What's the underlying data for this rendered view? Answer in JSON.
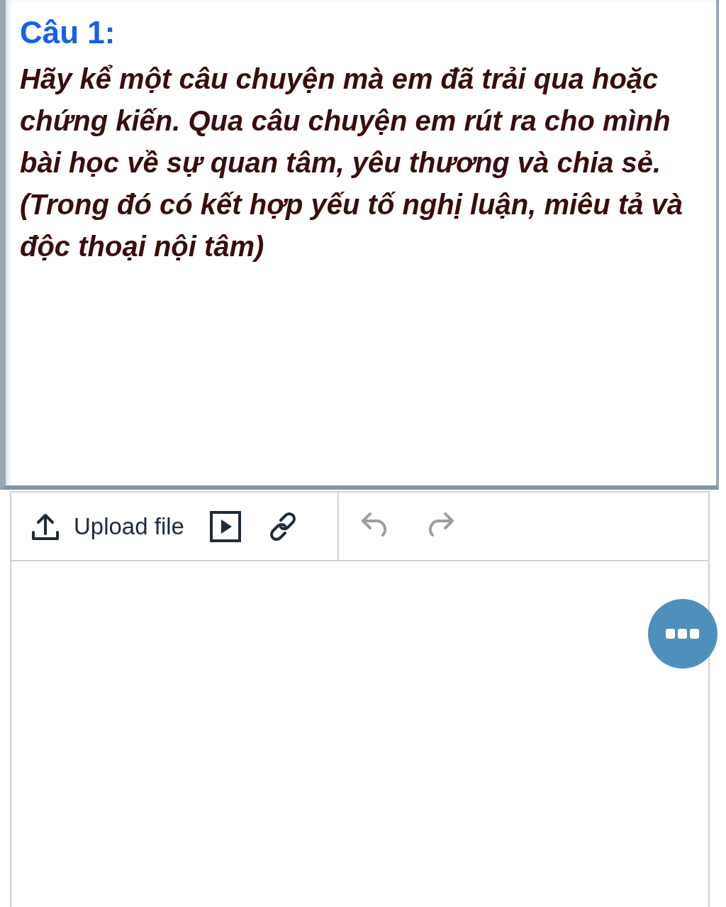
{
  "question": {
    "title": "Câu 1:",
    "text": "Hãy kể một câu chuyện mà em đã trải qua hoặc chứng kiến. Qua câu chuyện em rút ra cho mình bài học về sự quan tâm, yêu thương và chia sẻ. (Trong đó có kết hợp yếu tố nghị luận, miêu tả và độc thoại nội tâm)"
  },
  "toolbar": {
    "upload_label": "Upload file",
    "undo": {
      "disabled": true
    },
    "redo": {
      "disabled": true
    }
  }
}
